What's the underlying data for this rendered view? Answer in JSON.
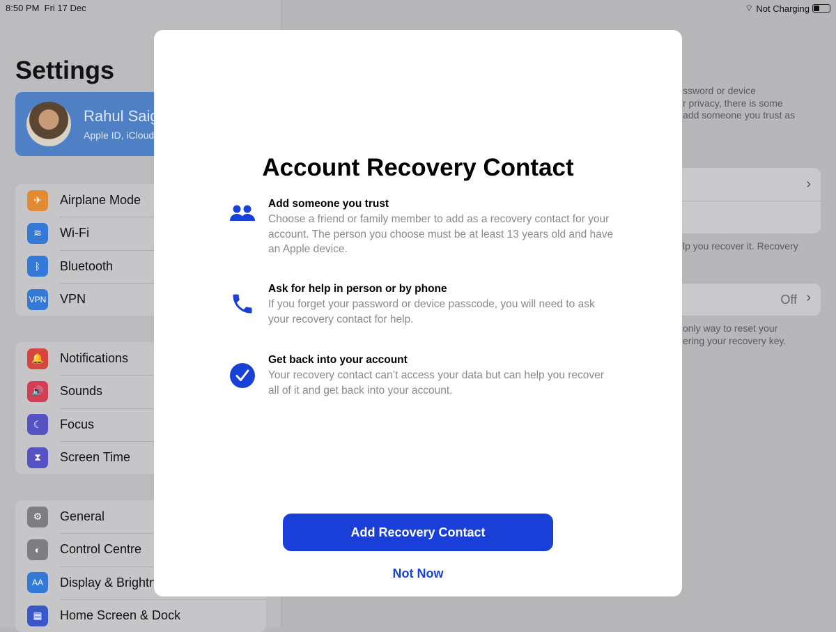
{
  "status": {
    "time": "8:50 PM",
    "date": "Fri 17 Dec",
    "charging": "Not Charging",
    "battery_percent": 35
  },
  "sidebar": {
    "title": "Settings",
    "account": {
      "name": "Rahul Saig",
      "subtitle": "Apple ID, iCloud"
    },
    "groups": [
      [
        {
          "label": "Airplane Mode",
          "icon": "airplane-icon",
          "color": "#e18b35",
          "glyph": "✈"
        },
        {
          "label": "Wi-Fi",
          "icon": "wifi-icon",
          "color": "#3479d6",
          "glyph": "≋"
        },
        {
          "label": "Bluetooth",
          "icon": "bluetooth-icon",
          "color": "#3479d6",
          "glyph": "ᛒ"
        },
        {
          "label": "VPN",
          "icon": "vpn-icon",
          "color": "#3479d6",
          "glyph": "VPN"
        }
      ],
      [
        {
          "label": "Notifications",
          "icon": "notifications-icon",
          "color": "#d6453e",
          "glyph": "🔔"
        },
        {
          "label": "Sounds",
          "icon": "sounds-icon",
          "color": "#d43e55",
          "glyph": "🔊"
        },
        {
          "label": "Focus",
          "icon": "moon-icon",
          "color": "#5552c4",
          "glyph": "☾"
        },
        {
          "label": "Screen Time",
          "icon": "hourglass-icon",
          "color": "#5552c4",
          "glyph": "⧗"
        }
      ],
      [
        {
          "label": "General",
          "icon": "gear-icon",
          "color": "#7d7d82",
          "glyph": "⚙"
        },
        {
          "label": "Control Centre",
          "icon": "toggles-icon",
          "color": "#7d7d82",
          "glyph": "◐"
        },
        {
          "label": "Display & Brightness",
          "icon": "display-icon",
          "color": "#3479d6",
          "glyph": "AA"
        },
        {
          "label": "Home Screen & Dock",
          "icon": "home-screen-icon",
          "color": "#3a57c8",
          "glyph": "▦"
        }
      ]
    ]
  },
  "detail": {
    "intro": [
      "ssword or device",
      "r privacy, there is some",
      "add someone you trust as"
    ],
    "contact_note": "lp you recover it. Recovery",
    "recovery_key_value": "Off",
    "key_note": [
      "only way to reset your",
      "ering your recovery key."
    ]
  },
  "modal": {
    "title": "Account Recovery Contact",
    "features": [
      {
        "title": "Add someone you trust",
        "desc": "Choose a friend or family member to add as a recovery contact for your account. The person you choose must be at least 13 years old and have an Apple device.",
        "icon": "people-icon"
      },
      {
        "title": "Ask for help in person or by phone",
        "desc": "If you forget your password or device passcode, you will need to ask your recovery contact for help.",
        "icon": "phone-icon"
      },
      {
        "title": "Get back into your account",
        "desc": "Your recovery contact can’t access your data but can help you recover all of it and get back into your account.",
        "icon": "checkmark-circle-icon"
      }
    ],
    "primary": "Add Recovery Contact",
    "secondary": "Not Now"
  },
  "colors": {
    "accent": "#1a3fd9"
  }
}
